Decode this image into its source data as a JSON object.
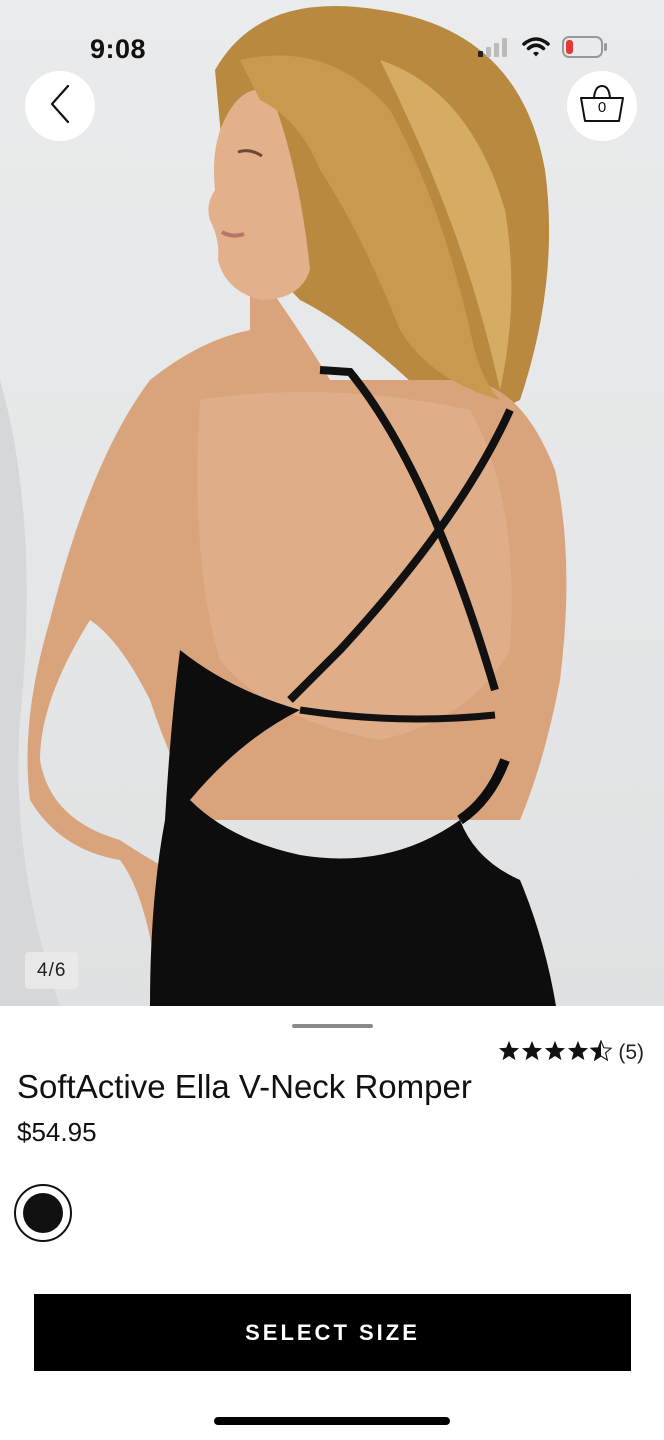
{
  "status_bar": {
    "time": "9:08"
  },
  "cart": {
    "count": "0"
  },
  "gallery": {
    "pager": "4/6"
  },
  "product": {
    "rating": 4.5,
    "rating_count": "(5)",
    "title": "SoftActive Ella V-Neck Romper",
    "price": "$54.95",
    "swatches": [
      {
        "color": "#111111",
        "selected": true
      }
    ]
  },
  "actions": {
    "select_size": "SELECT SIZE"
  },
  "icons": {
    "back": "chevron-left-icon",
    "cart": "shopping-basket-icon",
    "signal": "cellular-signal-icon",
    "wifi": "wifi-icon",
    "battery": "battery-low-icon",
    "star": "star-icon"
  },
  "colors": {
    "accent": "#000000",
    "battery_low": "#e53935"
  }
}
